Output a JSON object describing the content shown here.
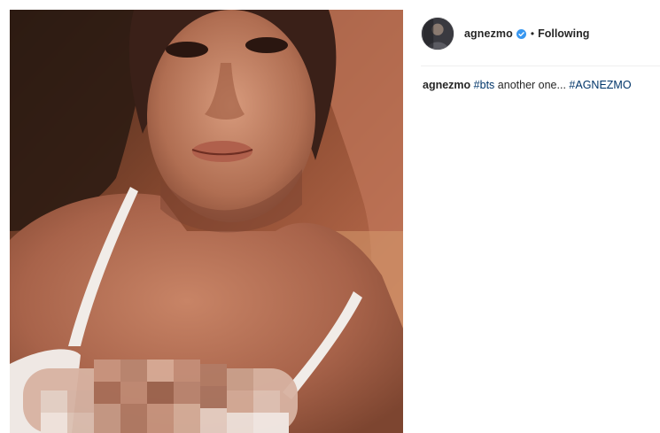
{
  "post": {
    "photo_alt": "selfie photo",
    "author": {
      "username": "agnezmo",
      "verified": true,
      "separator": "•",
      "follow_status": "Following"
    },
    "caption": {
      "username": "agnezmo",
      "hashtag_1": "#bts",
      "text": " another one... ",
      "hashtag_2": "#AGNEZMO"
    }
  },
  "colors": {
    "verified_badge": "#3897f0",
    "hashtag": "#003569",
    "text": "#262626",
    "divider": "#efefef"
  },
  "icons": {
    "verified": "verified-badge-icon"
  }
}
